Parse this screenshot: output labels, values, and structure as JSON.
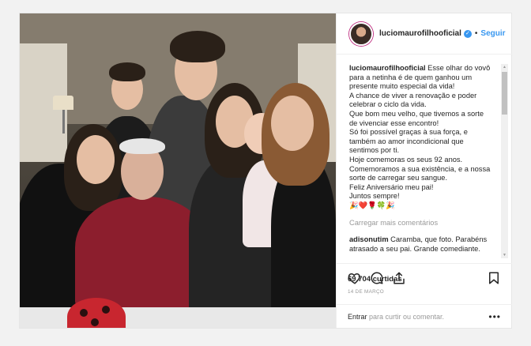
{
  "post": {
    "username": "luciomaurofilhooficial",
    "verified_icon": "verified-badge-icon",
    "dot": "•",
    "follow_label": "Seguir",
    "caption": {
      "user": "luciomaurofilhooficial",
      "lines": [
        " Esse olhar do vovô",
        "para a netinha é de quem ganhou um",
        "presente muito especial da vida!",
        "A chance de viver a renovação e poder",
        "celebrar o ciclo da vida.",
        "Que bom meu velho, que tivemos a sorte",
        "de vivenciar esse encontro!",
        "Só foi possível graças à sua força, e",
        "também ao amor incondicional que",
        "sentimos por ti.",
        "Hoje comemoras os seus 92 anos.",
        "Comemoramos a sua existência, e a nossa",
        "sorte de carregar seu sangue.",
        "Feliz Aniversário meu pai!",
        "Juntos sempre!",
        "🎉❤️🌹🍀🎉"
      ]
    },
    "load_more_label": "Carregar mais comentários",
    "comment": {
      "user": "adisonutim",
      "lines": [
        " Caramba, que foto. Parabéns",
        "atrasado a seu pai. Grande comediante."
      ]
    },
    "likes": "69.704 curtidas",
    "date": "14 DE MARÇO",
    "add_comment": {
      "login_label": "Entrar",
      "rest": " para curtir ou comentar.",
      "more_label": "•••"
    },
    "icons": {
      "like": "heart-icon",
      "comment": "comment-bubble-icon",
      "share": "share-arrow-icon",
      "save": "bookmark-icon"
    }
  }
}
